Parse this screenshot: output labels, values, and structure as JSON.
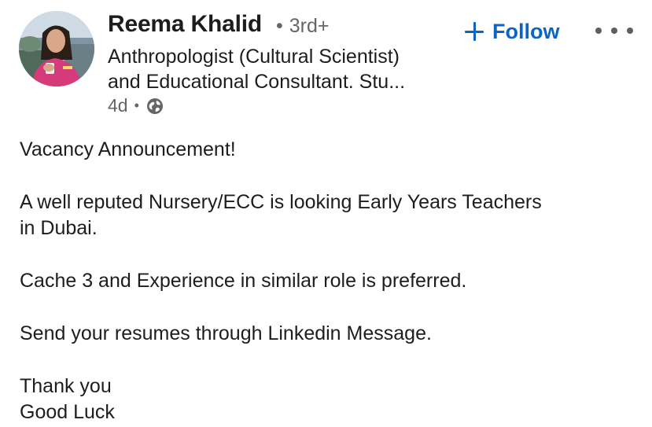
{
  "author": {
    "name": "Reema Khalid",
    "degree": "3rd+",
    "headline_line1": "Anthropologist (Cultural Scientist)",
    "headline_line2": "and Educational Consultant. Stu...",
    "time": "4d",
    "visibility_icon": "globe-icon"
  },
  "actions": {
    "follow_label": "Follow",
    "more_icon": "more-options-icon"
  },
  "post": {
    "line1": "Vacancy Announcement!",
    "line2": "A well reputed Nursery/ECC is looking Early Years Teachers",
    "line3": "in Dubai.",
    "line4": "Cache 3 and Experience in similar role is preferred.",
    "line5": "Send your resumes through Linkedin Message.",
    "line6": "Thank you",
    "line7": "Good Luck"
  },
  "colors": {
    "accent": "#0a66c2",
    "text": "#1d1d1d",
    "muted": "#666666"
  }
}
